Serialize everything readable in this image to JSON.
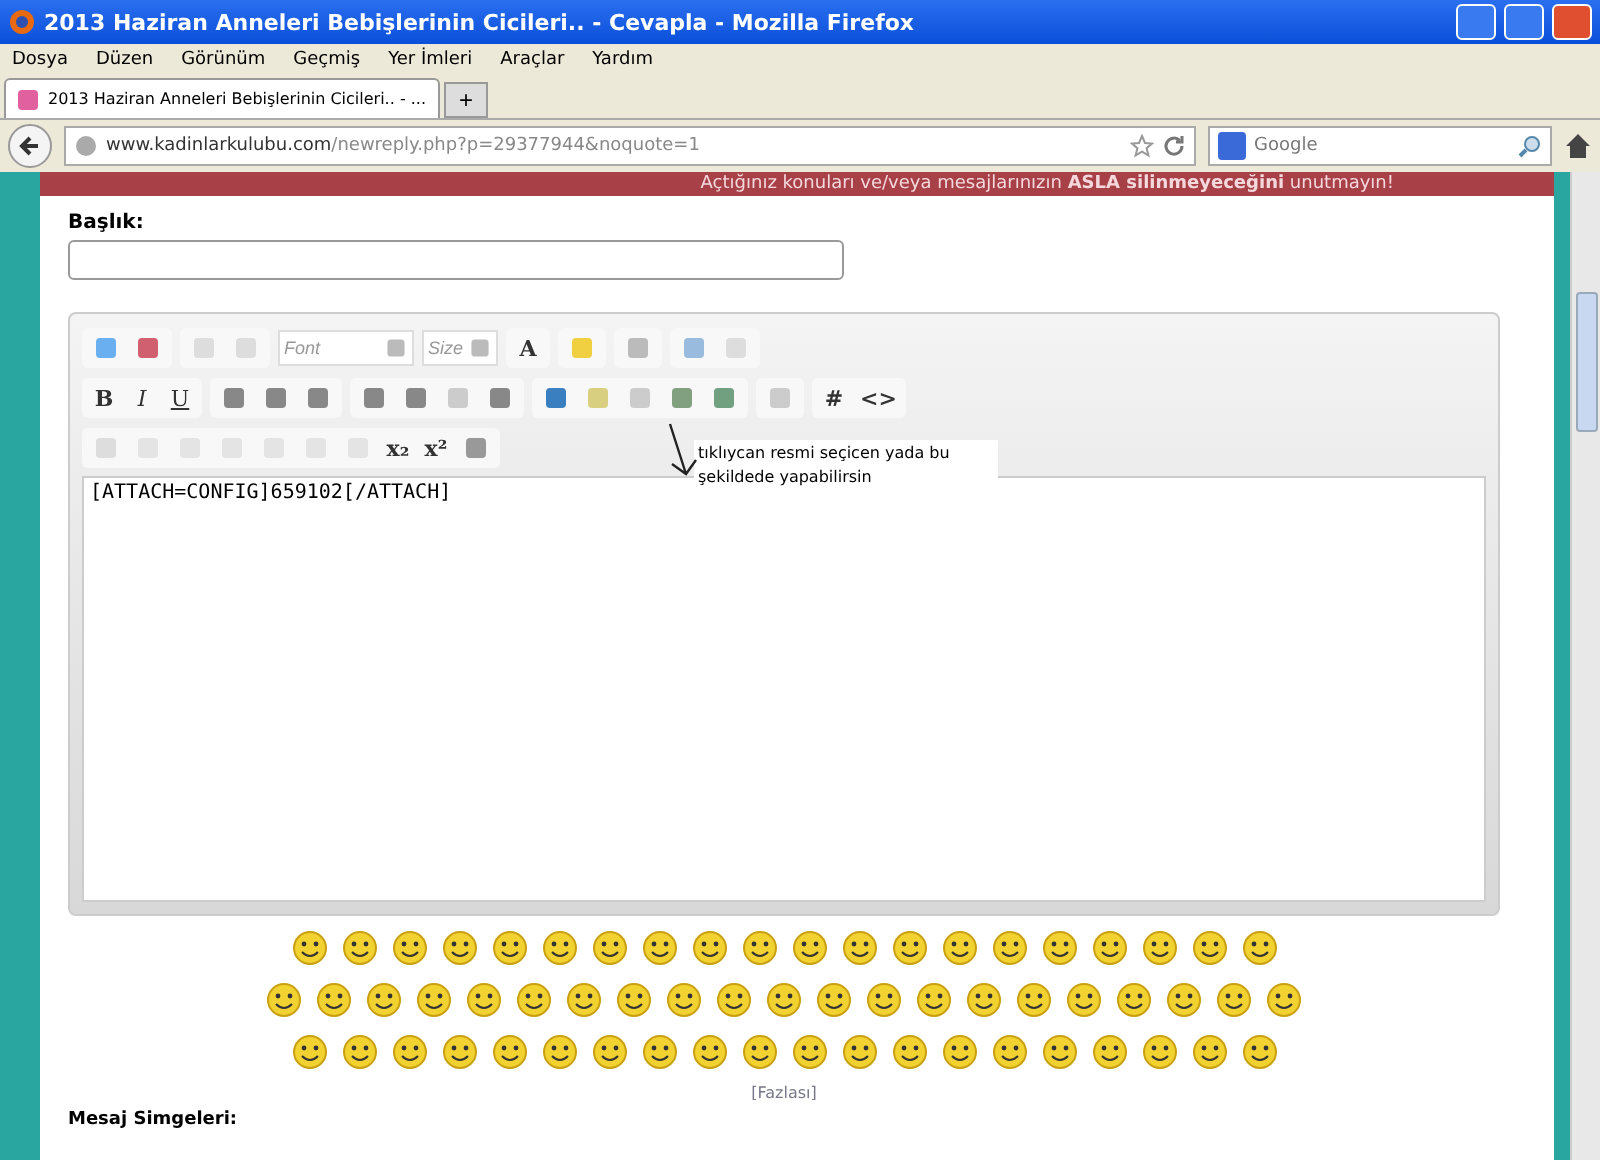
{
  "window": {
    "title": "2013 Haziran Anneleri Bebişlerinin Cicileri.. - Cevapla - Mozilla Firefox"
  },
  "menu": [
    "Dosya",
    "Düzen",
    "Görünüm",
    "Geçmiş",
    "Yer İmleri",
    "Araçlar",
    "Yardım"
  ],
  "tabs": [
    {
      "label": "2013 Haziran Anneleri Bebişlerinin Cicileri.. - ...",
      "selected": true
    }
  ],
  "new_tab": "+",
  "address_bar": {
    "domain": "www.kadinlarkulubu.com",
    "path": "/newreply.php?p=29377944&noquote=1"
  },
  "search": {
    "placeholder": "Google"
  },
  "banner": "Açtığınız konuları ve/veya mesajlarınızın **ASLA silinmeyeceğini** unutmayın!",
  "title_field": {
    "label": "Başlık:"
  },
  "toolbar": {
    "font": "Font",
    "size": "Size",
    "color_button": "A",
    "bold": "B",
    "italic": "I",
    "underline": "U",
    "hash": "#",
    "code": "<>",
    "subscript": "x₂",
    "superscript": "x²"
  },
  "editor": {
    "value": "[ATTACH=CONFIG]659102[/ATTACH]"
  },
  "annotation": "tıklıycan resmi seçicen yada bu şekildede yapabilirsin",
  "more_link": "[Fazlası]",
  "icons_label": "Mesaj Simgeleri:"
}
